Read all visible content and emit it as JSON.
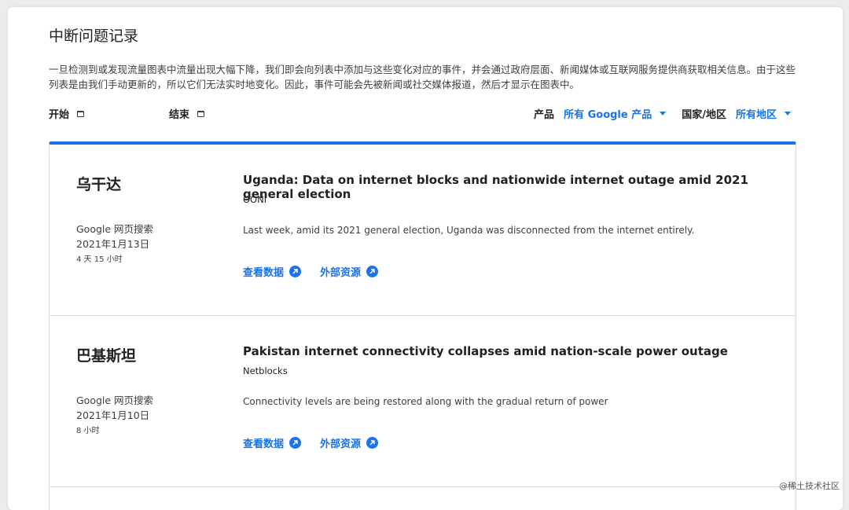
{
  "header": {
    "title": "中断问题记录",
    "intro": "一旦检测到或发现流量图表中流量出现大幅下降，我们即会向列表中添加与这些变化对应的事件，并会通过政府层面、新闻媒体或互联网服务提供商获取相关信息。由于这些列表是由我们手动更新的，所以它们无法实时地变化。因此，事件可能会先被新闻或社交媒体报道，然后才显示在图表中。"
  },
  "filters": {
    "start_label": "开始",
    "end_label": "结束",
    "product_label": "产品",
    "product_value": "所有 Google 产品",
    "region_label": "国家/地区",
    "region_value": "所有地区"
  },
  "entries": [
    {
      "country": "乌干达",
      "product": "Google 网页搜索",
      "date": "2021年1月13日",
      "duration": "4 天 15 小时",
      "headline": "Uganda: Data on internet blocks and nationwide internet outage amid 2021 general election",
      "source": "OONI",
      "summary": "Last week, amid its 2021 general election, Uganda was disconnected from the internet entirely.",
      "view_data": "查看数据",
      "external": "外部资源"
    },
    {
      "country": "巴基斯坦",
      "product": "Google 网页搜索",
      "date": "2021年1月10日",
      "duration": "8 小时",
      "headline": "Pakistan internet connectivity collapses amid nation-scale power outage",
      "source": "Netblocks",
      "summary": "Connectivity levels are being restored along with the gradual return of power",
      "view_data": "查看数据",
      "external": "外部资源"
    }
  ],
  "watermark": "@稀土技术社区",
  "colors": {
    "accent": "#1a73e8",
    "text": "#202124",
    "divider": "#dadce0"
  }
}
